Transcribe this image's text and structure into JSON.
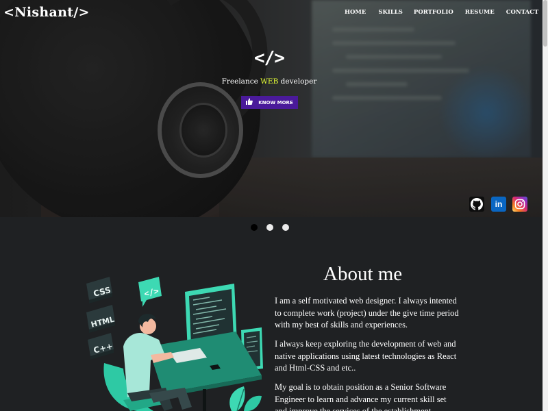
{
  "header": {
    "logo": "<Nishant/>",
    "nav": [
      "HOME",
      "SKILLS",
      "PORTFOLIO",
      "RESUME",
      "CONTACT"
    ]
  },
  "hero": {
    "icon_text": "</>",
    "tagline_pre": "Freelance ",
    "tagline_highlight": "WEB",
    "tagline_post": " developer",
    "button_label": "KNOW MORE",
    "highlight_color": "#e6ff35",
    "button_color": "#4a1a9a"
  },
  "social": {
    "icons": [
      "github-icon",
      "linkedin-icon",
      "instagram-icon"
    ],
    "linkedin_text": "in"
  },
  "carousel": {
    "active_index": 0,
    "count": 3
  },
  "about": {
    "title": "About me",
    "paragraphs": [
      "I am a self motivated web designer. I always intented to complete work (project) under the give time period with my best of skills and experiences.",
      "I always keep exploring the development of web and native applications using latest technologies as React and Html-CSS and etc..",
      "My goal is to obtain position as a Senior Software Engineer to learn and advance my current skill set and improve the services of the establishment."
    ],
    "illustration": {
      "badges": [
        "CSS",
        "HTML",
        "C++"
      ],
      "bubble": "</>"
    }
  }
}
